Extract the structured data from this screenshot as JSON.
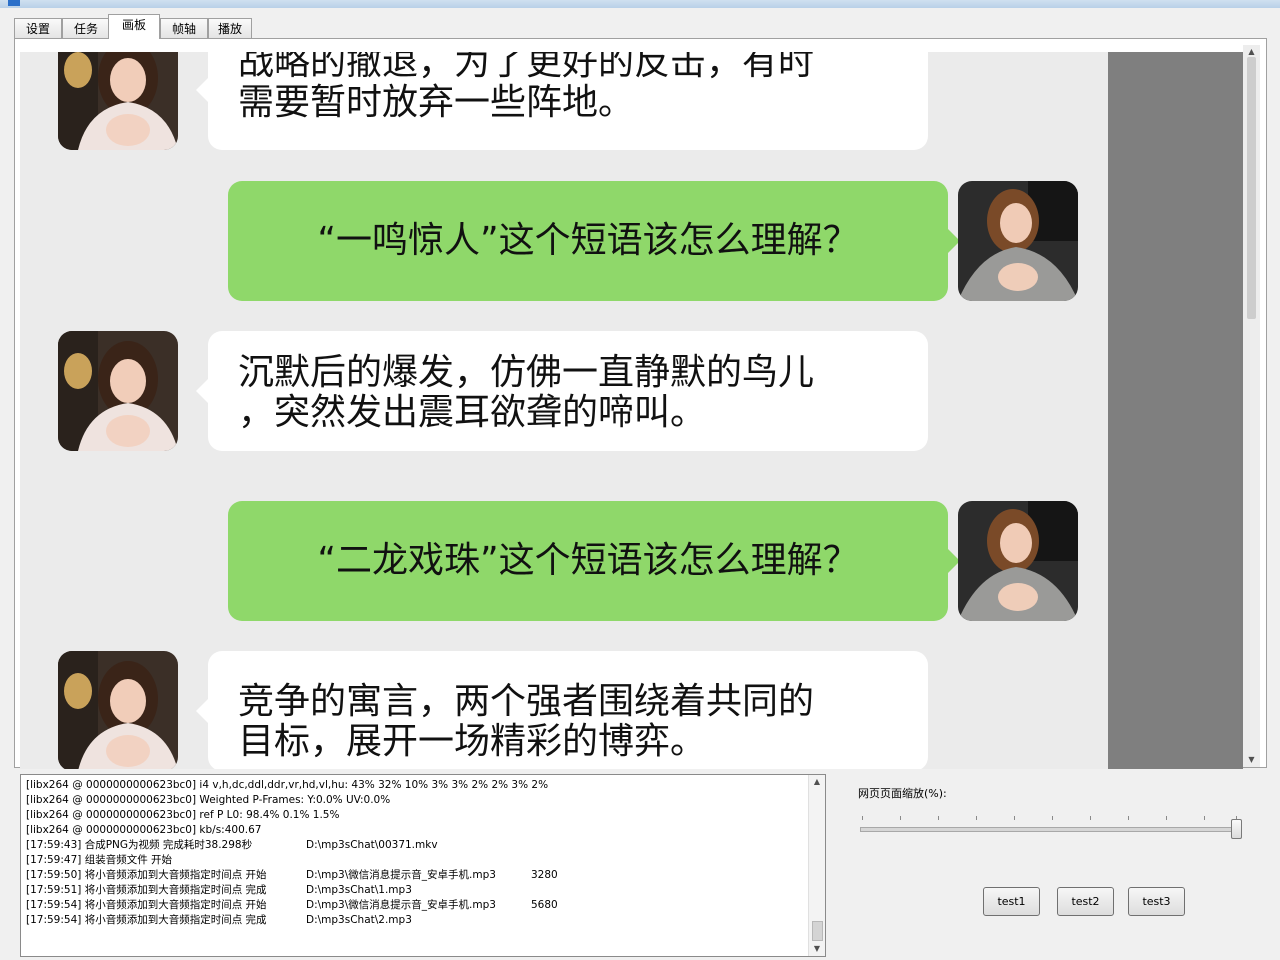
{
  "tabs": [
    {
      "label": "设置"
    },
    {
      "label": "任务"
    },
    {
      "label": "画板",
      "active": true
    },
    {
      "label": "帧轴"
    },
    {
      "label": "播放"
    }
  ],
  "chat": {
    "messages": [
      {
        "side": "left",
        "lines": [
          "战略的撤退，为了更好的反击，有时",
          "需要暂时放弃一些阵地。"
        ]
      },
      {
        "side": "right",
        "lines": [
          "“一鸣惊人”这个短语该怎么理解？"
        ]
      },
      {
        "side": "left",
        "lines": [
          "沉默后的爆发，仿佛一直静默的鸟儿",
          "，突然发出震耳欲聋的啼叫。"
        ]
      },
      {
        "side": "right",
        "lines": [
          "“二龙戏珠”这个短语该怎么理解？"
        ]
      },
      {
        "side": "left",
        "lines": [
          "竞争的寓言，两个强者围绕着共同的",
          "目标，展开一场精彩的博弈。"
        ]
      }
    ],
    "colors": {
      "background": "#ebebeb",
      "left_bubble": "#ffffff",
      "right_bubble": "#8fd86a"
    }
  },
  "log": {
    "lines": [
      [
        "[libx264 @ 0000000000623bc0] i4 v,h,dc,ddl,ddr,vr,hd,vl,hu: 43% 32% 10%  3%  3%  2%  2%  3%  2%"
      ],
      [
        "[libx264 @ 0000000000623bc0] Weighted P-Frames: Y:0.0% UV:0.0%"
      ],
      [
        "[libx264 @ 0000000000623bc0] ref P L0: 98.4%  0.1%  1.5%"
      ],
      [
        "[libx264 @ 0000000000623bc0] kb/s:400.67"
      ],
      [
        "[17:59:43]  合成PNG为视频 完成耗时38.298秒",
        "D:\\mp3sChat\\00371.mkv"
      ],
      [
        "[17:59:47]  组装音频文件 开始"
      ],
      [
        "[17:59:50]  将小音频添加到大音频指定时间点 开始",
        "D:\\mp3\\微信消息提示音_安卓手机.mp3",
        "3280"
      ],
      [
        "[17:59:51]  将小音频添加到大音频指定时间点 完成",
        "D:\\mp3sChat\\1.mp3"
      ],
      [
        "[17:59:54]  将小音频添加到大音频指定时间点 开始",
        "D:\\mp3\\微信消息提示音_安卓手机.mp3",
        "5680"
      ],
      [
        "[17:59:54]  将小音频添加到大音频指定时间点 完成",
        "D:\\mp3sChat\\2.mp3"
      ]
    ]
  },
  "zoom": {
    "label": "网页页面缩放(%):",
    "level_fraction": 1.0
  },
  "buttons": {
    "test1": "test1",
    "test2": "test2",
    "test3": "test3"
  },
  "icons": {
    "scroll_up": "▲",
    "scroll_down": "▼"
  }
}
